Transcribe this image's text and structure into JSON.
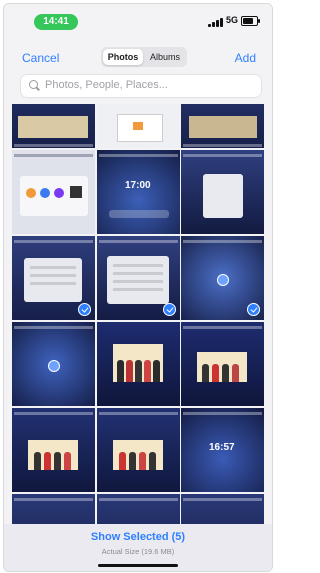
{
  "status_bar": {
    "time": "14:41",
    "network": "5G"
  },
  "header": {
    "cancel": "Cancel",
    "add": "Add",
    "tabs": [
      {
        "label": "Photos",
        "active": true
      },
      {
        "label": "Albums",
        "active": false
      }
    ]
  },
  "search": {
    "placeholder": "Photos, People, Places..."
  },
  "clock_labels": [
    "17:00",
    "16:57"
  ],
  "footer": {
    "show_selected": "Show Selected (5)",
    "actual_size": "Actual Size (19.6 MB)"
  },
  "colors": {
    "accent": "#2f80ff",
    "time_pill": "#35c759"
  },
  "selected_count": 5
}
